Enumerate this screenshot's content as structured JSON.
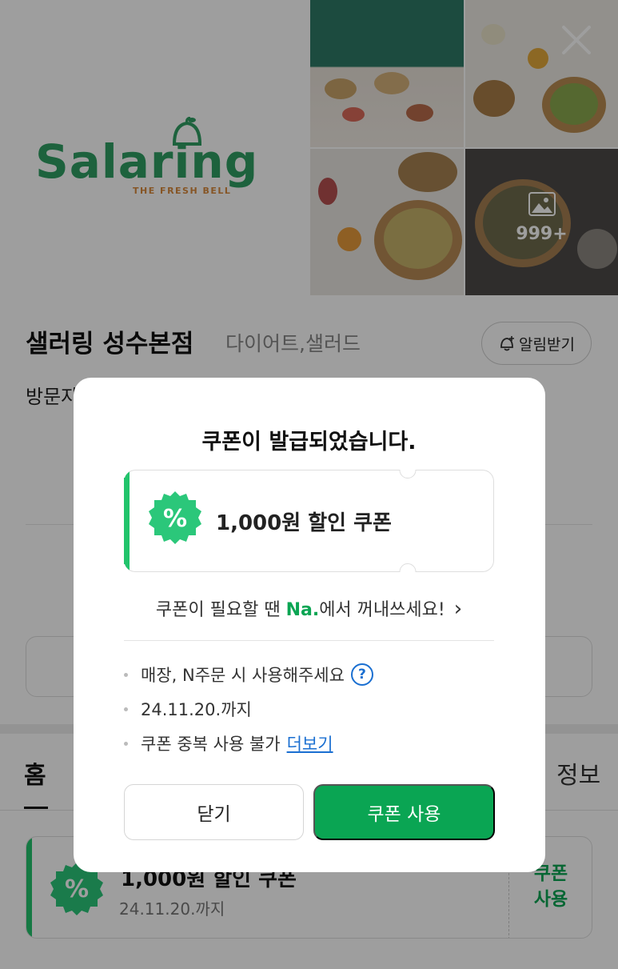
{
  "header": {
    "back_glyph": "‹",
    "brand_name": "Salaring",
    "brand_tagline": "THE FRESH BELL",
    "photo_count": "999+",
    "icons": [
      "back-arrow-icon",
      "close-icon",
      "gallery-icon",
      "bell-logo-icon"
    ]
  },
  "store": {
    "name": "샐러링 성수본점",
    "category": "다이어트,샐러드",
    "notify_label": "알림받기",
    "visit_text_partial": "방문자"
  },
  "tabs": {
    "home": "홈",
    "info": "정보"
  },
  "background_coupon": {
    "title": "1,000원 할인 쿠폰",
    "date": "24.11.20.까지",
    "use_line1": "쿠폰",
    "use_line2": "사용"
  },
  "modal": {
    "title": "쿠폰이 발급되었습니다.",
    "coupon_label": "1,000원 할인 쿠폰",
    "badge_symbol": "%",
    "pull_prefix": "쿠폰이 필요할 땐 ",
    "pull_brand": "Na.",
    "pull_suffix": "에서 꺼내쓰세요!",
    "pull_chevron": "›",
    "info": {
      "usage": "매장, N주문 시 사용해주세요",
      "help_glyph": "?",
      "expiry": "24.11.20.까지",
      "no_duplicate": "쿠폰 중복 사용 불가",
      "more_link": "더보기"
    },
    "close_label": "닫기",
    "use_label": "쿠폰 사용"
  },
  "colors": {
    "accent_green": "#0aa553",
    "brand_green": "#2f9e63",
    "link_blue": "#1a6fd1",
    "overlay": "rgba(0,0,0,0.38)"
  }
}
